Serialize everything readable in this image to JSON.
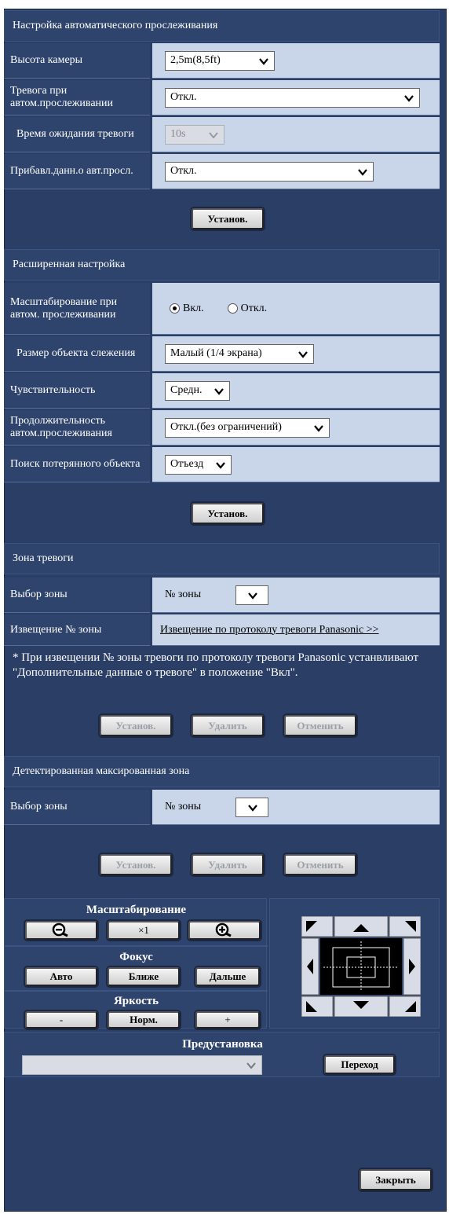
{
  "auto_tracking": {
    "title": "Настройка автоматического прослеживания",
    "camera_height_label": "Высота камеры",
    "camera_height_value": "2,5m(8,5ft)",
    "alarm_label": "Тревога при автом.прослеживании",
    "alarm_value": "Откл.",
    "wait_label": "Время ожидания тревоги",
    "wait_value": "10s",
    "extra_label": "Прибавл.данн.о авт.просл.",
    "extra_value": "Откл.",
    "set_button": "Установ."
  },
  "advanced": {
    "title": "Расширенная настройка",
    "zoom_label": "Масштабирование при автом. прослеживании",
    "zoom_on": "Вкл.",
    "zoom_off": "Откл.",
    "object_size_label": "Размер объекта слежения",
    "object_size_value": "Малый (1/4 экрана)",
    "sensitivity_label": "Чувствительность",
    "sensitivity_value": "Средн.",
    "duration_label": "Продолжительность автом.прослеживания",
    "duration_value": "Откл.(без ограничений)",
    "lost_label": "Поиск потерянного объекта",
    "lost_value": "Отъезд",
    "set_button": "Установ."
  },
  "alarm_zone": {
    "title": "Зона тревоги",
    "zone_select_label": "Выбор зоны",
    "zone_no": "№ зоны",
    "notify_label": "Извещение № зоны",
    "notify_link": "Извещение по протоколу тревоги Panasonic >>",
    "note": "* При извещении № зоны тревоги по протоколу тревоги Panasonic устанвливают \"Дополнительные данные о тревоге\" в положение \"Вкл\".",
    "set_button": "Установ.",
    "delete_button": "Удалить",
    "cancel_button": "Отменить"
  },
  "mask_zone": {
    "title": "Детектированная максированная зона",
    "zone_select_label": "Выбор зоны",
    "zone_no": "№ зоны",
    "set_button": "Установ.",
    "delete_button": "Удалить",
    "cancel_button": "Отменить"
  },
  "control": {
    "zoom_title": "Масштабирование",
    "zoom_x1": "×1",
    "focus_title": "Фокус",
    "focus_auto": "Авто",
    "focus_near": "Ближе",
    "focus_far": "Дальше",
    "brightness_title": "Яркость",
    "bright_minus": "-",
    "bright_norm": "Норм.",
    "bright_plus": "+",
    "preset_title": "Предустановка",
    "preset_value": "",
    "go_button": "Переход"
  },
  "close_button": "Закрыть",
  "colors": {
    "panel": "#2b3f66",
    "value_bg": "#c9d6ea",
    "header": "#2e446d"
  }
}
